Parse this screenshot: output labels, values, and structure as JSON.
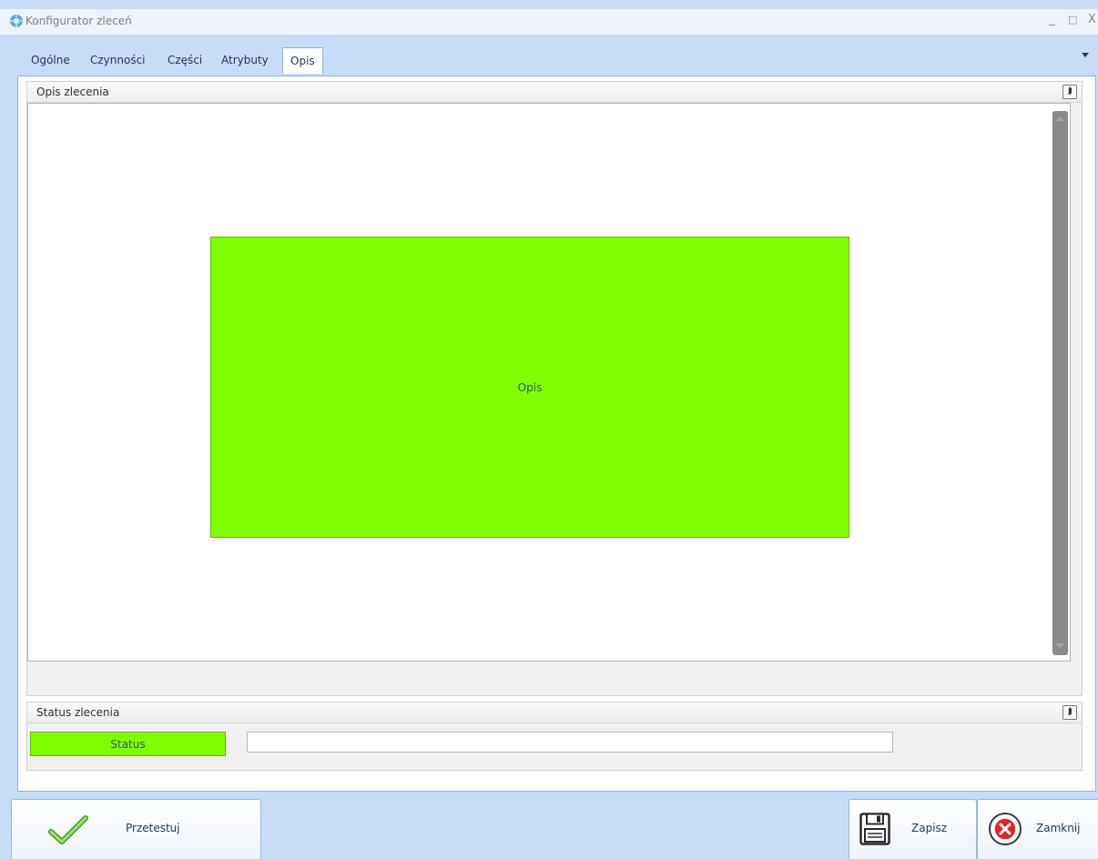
{
  "window": {
    "title": "Konfigurator zleceń",
    "minimize_glyph": "_",
    "maximize_glyph": "□",
    "close_glyph": "X"
  },
  "tabs": [
    {
      "label": "Ogólne",
      "active": false
    },
    {
      "label": "Czynności",
      "active": false
    },
    {
      "label": "Części",
      "active": false
    },
    {
      "label": "Atrybuty",
      "active": false
    },
    {
      "label": "Opis",
      "active": true
    }
  ],
  "description_group": {
    "title": "Opis zlecenia",
    "collapse_icon": "double-chevron-up-icon",
    "opis_field": {
      "label": "Opis",
      "color": "#7fff00"
    }
  },
  "status_group": {
    "title": "Status zlecenia",
    "collapse_icon": "double-chevron-up-icon",
    "status_field": {
      "label": "Status",
      "color": "#7fff00"
    },
    "status_input_value": ""
  },
  "actions": {
    "test_label": "Przetestuj",
    "save_label": "Zapisz",
    "close_label": "Zamknij"
  },
  "colors": {
    "window_background": "#c9dcf6",
    "accent_green": "#7fff00",
    "close_red": "#e0262c"
  }
}
